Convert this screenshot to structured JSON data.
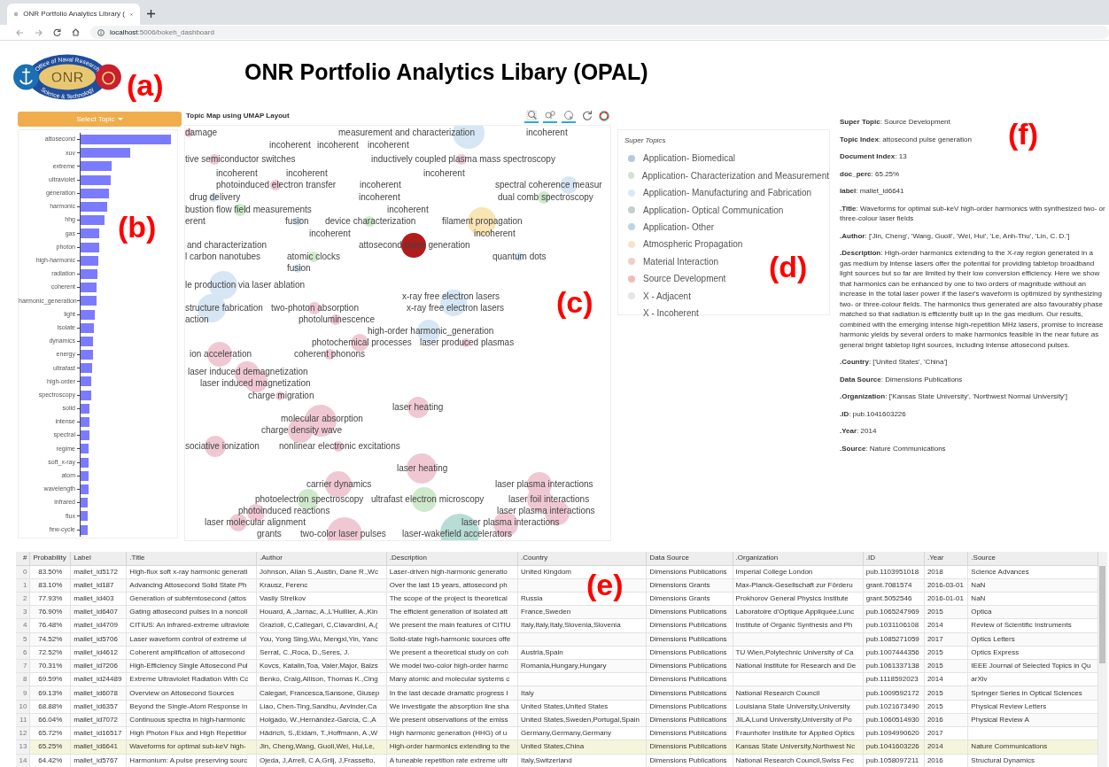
{
  "browser": {
    "tab_title": "ONR Portfolio Analytics Library (",
    "url_host": "localhost",
    "url_path": ":5006/bokeh_dashboard"
  },
  "logo": {
    "center": "ONR",
    "top_ring": "Office of Naval Research",
    "bottom_ring": "Science & Technology"
  },
  "title": "ONR Portfolio Analytics Libary (OPAL)",
  "annotations": [
    "(a)",
    "(b)",
    "(c)",
    "(d)",
    "(e)",
    "(f)"
  ],
  "topic_select": {
    "label": "Select Topic"
  },
  "term_chart": {
    "terms": [
      "attosecond",
      "xuv",
      "extreme",
      "ultraviolet",
      "generation",
      "harmonic",
      "hhg",
      "gas",
      "photon",
      "high-harmonic",
      "radiation",
      "coherent",
      "harmonic_generation",
      "light",
      "isolate",
      "dynamics",
      "energy",
      "ultrafast",
      "high-order",
      "spectroscopy",
      "solid",
      "intense",
      "spectral",
      "regime",
      "soft_x-ray",
      "atom",
      "wavelength",
      "infrared",
      "flux",
      "few-cycle"
    ]
  },
  "map": {
    "title": "Topic Map using UMAP Layout",
    "tools": [
      {
        "kind": "box_zoom",
        "active": true
      },
      {
        "kind": "wheel_zoom",
        "active": true
      },
      {
        "kind": "tap",
        "active": true
      },
      {
        "kind": "reset",
        "active": false
      }
    ],
    "points": [
      {
        "label": "damage",
        "color": "#f0c8d4"
      },
      {
        "label": "measurement and characterization",
        "color": "#d6e6f4"
      },
      {
        "label": "incoherent"
      },
      {
        "label": "incoherent"
      },
      {
        "label": "incoherent"
      },
      {
        "label": "incoherent"
      },
      {
        "label": "tive semiconductor switches",
        "color": "#f0c8d4"
      },
      {
        "label": "inductively coupled plasma mass spectroscopy",
        "color": "#f0c8d4"
      },
      {
        "label": "incoherent"
      },
      {
        "label": "incoherent"
      },
      {
        "label": "incoherent"
      },
      {
        "label": "photoinduced electron transfer",
        "color": "#f0c8d4"
      },
      {
        "label": "incoherent"
      },
      {
        "label": "spectral coherence measur",
        "color": "#d6e6f4"
      },
      {
        "label": "drug delivery",
        "color": "#d6e6f4"
      },
      {
        "label": "incoherent"
      },
      {
        "label": "dual comb spectroscopy",
        "color": "#cfe9cc"
      },
      {
        "label": "bustion flow field measurements",
        "color": "#cfe9cc"
      },
      {
        "label": "incoherent"
      },
      {
        "label": "erent"
      },
      {
        "label": "fusion",
        "color": "#d6e6f4"
      },
      {
        "label": "device characterization",
        "color": "#cfe9cc"
      },
      {
        "label": "filament propagation",
        "color": "#f9e4b4"
      },
      {
        "label": "incoherent"
      },
      {
        "label": "incoherent"
      },
      {
        "label": "and characterization"
      },
      {
        "label": "attosecond pulse generation",
        "color": "#b01c1c"
      },
      {
        "label": "l carbon nanotubes"
      },
      {
        "label": "atomic clocks",
        "color": "#cfe9cc"
      },
      {
        "label": "quantum dots",
        "color": "#d6e6f4"
      },
      {
        "label": "fusion",
        "color": "#d6e6f4"
      },
      {
        "label": "le production via laser ablation",
        "color": "#d6e6f4"
      },
      {
        "label": "x-ray free electron lasers"
      },
      {
        "label": "structure fabrication",
        "color": "#d6e6f4"
      },
      {
        "label": "two-photon absorption",
        "color": "#f0c8d4"
      },
      {
        "label": "x-ray free electron lasers",
        "color": "#d6e6f4"
      },
      {
        "label": "action"
      },
      {
        "label": "photoluminescence",
        "color": "#f0c8d4"
      },
      {
        "label": "high-order harmonic_generation",
        "color": "#d6e6f4"
      },
      {
        "label": "photochemical processes",
        "color": "#f0c8d4"
      },
      {
        "label": "laser produced plasmas",
        "color": "#f0c8d4"
      },
      {
        "label": "ion acceleration",
        "color": "#f0c8d4"
      },
      {
        "label": "coherent phonons",
        "color": "#f0c8d4"
      },
      {
        "label": "laser induced demagnetization",
        "color": "#f0c8d4"
      },
      {
        "label": "laser induced magnetization",
        "color": "#f0c8d4"
      },
      {
        "label": "charge migration",
        "color": "#f0c8d4"
      },
      {
        "label": "laser heating",
        "color": "#f0c8d4"
      },
      {
        "label": "molecular absorption",
        "color": "#f0c8d4"
      },
      {
        "label": "charge density wave",
        "color": "#f0c8d4"
      },
      {
        "label": "sociative ionization",
        "color": "#f0c8d4"
      },
      {
        "label": "nonlinear electronic excitations",
        "color": "#f0c8d4"
      },
      {
        "label": "laser heating",
        "color": "#f0c8d4"
      },
      {
        "label": "carrier dynamics",
        "color": "#f0c8d4"
      },
      {
        "label": "laser plasma interactions",
        "color": "#f0c8d4"
      },
      {
        "label": "photoelectron spectroscopy",
        "color": "#cfe9cc"
      },
      {
        "label": "ultrafast electron microscopy",
        "color": "#cfe9cc"
      },
      {
        "label": "laser foil interactions",
        "color": "#f0c8d4"
      },
      {
        "label": "photoinduced reactions",
        "color": "#f0c8d4"
      },
      {
        "label": "laser plasma interactions",
        "color": "#f0c8d4"
      },
      {
        "label": "laser molecular alignment",
        "color": "#f0c8d4"
      },
      {
        "label": "laser plasma interactions",
        "color": "#f0c8d4"
      },
      {
        "label": "grants"
      },
      {
        "label": "two-color laser pulses",
        "color": "#f0c8d4"
      },
      {
        "label": "laser-wakefield accelerators",
        "color": "#b8dcd6"
      }
    ]
  },
  "legend": {
    "title": "Super Topics",
    "items": [
      {
        "label": "Application- Biomedical",
        "color": "#b7c9dd"
      },
      {
        "label": "Application- Characterization and Measurement",
        "color": "#d9dfd8"
      },
      {
        "label": "Application- Manufacturing and Fabrication",
        "color": "#dbe9f4"
      },
      {
        "label": "Application- Optical Communication",
        "color": "#c6cfc9"
      },
      {
        "label": "Application- Other",
        "color": "#bcd7e3"
      },
      {
        "label": "Atmospheric Propagation",
        "color": "#f6e3cb"
      },
      {
        "label": "Material Interaction",
        "color": "#f0cfc8"
      },
      {
        "label": "Source Development",
        "color": "#f2bdb8"
      },
      {
        "label": "X - Adjacent",
        "color": "#e6e6e6"
      },
      {
        "label": "X - Incoherent"
      }
    ]
  },
  "details": [
    "**Super Topic**: Source Development",
    "**Topic Index**: attosecond pulse generation",
    "**Document Index**: 13",
    "**doc_perc**: 65.25%",
    "**label**: mallet_id6641",
    "**.Title**: Waveforms for optimal sub-keV high-order harmonics with synthesized two- or three-colour laser fields",
    "**.Author**: ['Jin, Cheng', 'Wang, Guoli', 'Wei, Hui', 'Le, Anh-Thu', 'Lin, C. D.']",
    "**.Description**: High-order harmonics extending to the X-ray region generated in a gas medium by intense lasers offer the potential for providing tabletop broadband light sources but so far are limited by their low conversion efficiency. Here we show that harmonics can be enhanced by one to two orders of magnitude without an increase in the total laser power if the laser's waveform is optimized by synthesizing two- or three-colour fields. The harmonics thus generated are also favourably phase matched so that radiation is efficiently built up in the gas medium. Our results, combined with the emerging intense high-repetition MHz lasers, promise to increase harmonic yields by several orders to make harmonics feasible in the near future as general bright tabletop light sources, including intense attosecond pulses.",
    "**.Country**: ['United States', 'China']",
    "**Data Source**: Dimensions Publications",
    "**.Organization**: ['Kansas State University', 'Northwest Normal University']",
    "**.ID**: pub.1041603226",
    "**.Year**: 2014",
    "**.Source**: Nature Communications"
  ],
  "table": {
    "columns": [
      "#",
      "Probability",
      "Label",
      ".Title",
      ".Author",
      ".Description",
      ".Country",
      "Data Source",
      ".Organization",
      ".ID",
      ".Year",
      ".Source"
    ],
    "rows": [
      {
        "selected": false,
        "cells": [
          "0",
          "83.50%",
          "mallet_id5172",
          "High-flux soft x-ray harmonic generati",
          "Johnson, Allan S.,Austin, Dane R.,Wc",
          "Laser-driven high-harmonic generatio",
          "United Kingdom",
          "Dimensions Publications",
          "Imperial College London",
          "pub.1103951018",
          "2018",
          "Science Advances"
        ]
      },
      {
        "selected": false,
        "cells": [
          "1",
          "83.10%",
          "mallet_id187",
          "Advancing Attosecond Solid State Ph",
          "Krausz, Ferenc",
          "Over the last 15 years, attosecond ph",
          null,
          "Dimensions Grants",
          "Max-Planck-Gesellschaft zur Förderu",
          "grant.7081574",
          "2016-03-01",
          "NaN"
        ]
      },
      {
        "selected": false,
        "cells": [
          "2",
          "77.93%",
          "mallet_id403",
          "Generation of subfemtosecond (attos",
          "Vasily Strelkov",
          "The scope of the project is theoretical",
          "Russia",
          "Dimensions Grants",
          "Prokhorov General Physics Institute",
          "grant.5052546",
          "2016-01-01",
          "NaN"
        ]
      },
      {
        "selected": false,
        "cells": [
          "3",
          "76.90%",
          "mallet_id6407",
          "Gating attosecond pulses in a noncoll",
          "Houard, A.,Jarnac, A.,L'Huillier, A.,Kin",
          "The efficient generation of isolated att",
          "France,Sweden",
          "Dimensions Publications",
          "Laboratoire d'Optique Appliquée,Lunc",
          "pub.1065247969",
          "2015",
          "Optica"
        ]
      },
      {
        "selected": false,
        "cells": [
          "4",
          "76.48%",
          "mallet_id4709",
          "CITIUS: An infrared-extreme ultraviole",
          "Grazioli, C,Callegari, C,Ciavardini, A,(",
          "We present the main features of CITIU",
          "Italy,Italy,Italy,Slovenia,Slovenia",
          "Dimensions Publications",
          "Institute of Organic Synthesis and Ph",
          "pub.1031106108",
          "2014",
          "Review of Scientific Instruments"
        ]
      },
      {
        "selected": false,
        "cells": [
          "5",
          "74.52%",
          "mallet_id5706",
          "Laser waveform control of extreme ul",
          "You, Yong Sing,Wu, Mengxi,Yin, Yanc",
          "Solid-state high-harmonic sources offe",
          null,
          "Dimensions Publications",
          null,
          "pub.1085271059",
          "2017",
          "Optics Letters"
        ]
      },
      {
        "selected": false,
        "cells": [
          "6",
          "72.52%",
          "mallet_id4612",
          "Coherent amplification of attosecond",
          "Serrat, C.,Roca, D.,Seres, J.",
          "We present a theoretical study on coh",
          "Austria,Spain",
          "Dimensions Publications",
          "TU Wien,Polytechnic University of Ca",
          "pub.1007444356",
          "2015",
          "Optics Express"
        ]
      },
      {
        "selected": false,
        "cells": [
          "7",
          "70.31%",
          "mallet_id7206",
          "High-Efficiency Single Attosecond Pul",
          "Kovcs, Katalin,Toa, Valer,Major, Balzs",
          "We model two-color high-order harmc",
          "Romania,Hungary,Hungary",
          "Dimensions Publications",
          "National Institute for Research and De",
          "pub.1061337138",
          "2015",
          "IEEE Journal of Selected Topics in Qu"
        ]
      },
      {
        "selected": false,
        "cells": [
          "8",
          "69.59%",
          "mallet_id24489",
          "Extreme Ultraviolet Radiation With Cc",
          "Benko, Craig,Allison, Thomas K.,Cing",
          "Many atomic and molecular systems c",
          null,
          "Dimensions Publications",
          null,
          "pub.1118592023",
          "2014",
          "arXiv"
        ]
      },
      {
        "selected": false,
        "cells": [
          "9",
          "69.13%",
          "mallet_id6078",
          "Overview on Attosecond Sources",
          "Calegari, Francesca,Sansone, Giusep",
          "In the last decade dramatic progress I",
          "Italy",
          "Dimensions Publications",
          "National Research Council",
          "pub.1009592172",
          "2015",
          "Springer Series in Optical Sciences"
        ]
      },
      {
        "selected": false,
        "cells": [
          "10",
          "68.88%",
          "mallet_id6357",
          "Beyond the Single-Atom Response in",
          "Liao, Chen-Ting,Sandhu, Arvinder,Ca",
          "We investigate the absorption line sha",
          "United States,United States",
          "Dimensions Publications",
          "Louisiana State University,University",
          "pub.1021673490",
          "2015",
          "Physical Review Letters"
        ]
      },
      {
        "selected": false,
        "cells": [
          "11",
          "66.04%",
          "mallet_id7072",
          "Continuous spectra in high-harmonic",
          "Holgado, W.,Hernández-García, C.,A",
          "We present observations of the emiss",
          "United States,Sweden,Portugal,Spain",
          "Dimensions Publications",
          "JILA,Lund University,University of Po",
          "pub.1060514930",
          "2016",
          "Physical Review A"
        ]
      },
      {
        "selected": false,
        "cells": [
          "12",
          "65.72%",
          "mallet_id16517",
          "High Photon Flux and High Repetitior",
          "Hädrich, S.,Eidam, T.,Hoffmann, A.,W",
          "High harmonic generation (HHG) of u",
          "Germany,Germany,Germany",
          "Dimensions Publications",
          "Fraunhofer Institute for Applied Optics",
          "pub.1094990620",
          "2017",
          null
        ]
      },
      {
        "selected": true,
        "cells": [
          "13",
          "65.25%",
          "mallet_id6641",
          "Waveforms for optimal sub-keV high-",
          "Jin, Cheng,Wang, Guoli,Wei, Hui,Le,",
          "High-order harmonics extending to the",
          "United States,China",
          "Dimensions Publications",
          "Kansas State University,Northwest Nc",
          "pub.1041603226",
          "2014",
          "Nature Communications"
        ]
      },
      {
        "selected": false,
        "cells": [
          "14",
          "64.42%",
          "mallet_id5767",
          "Harmonium: A pulse preserving sourc",
          "Ojeda, J,Arrell, C A,Grilj, J,Frassetto,",
          "A tuneable repetition rate extreme ultr",
          "Italy,Switzerland",
          "Dimensions Publications",
          "National Research Council,Swiss Fec",
          "pub.1058097211",
          "2016",
          "Structural Dynamics"
        ]
      }
    ]
  }
}
